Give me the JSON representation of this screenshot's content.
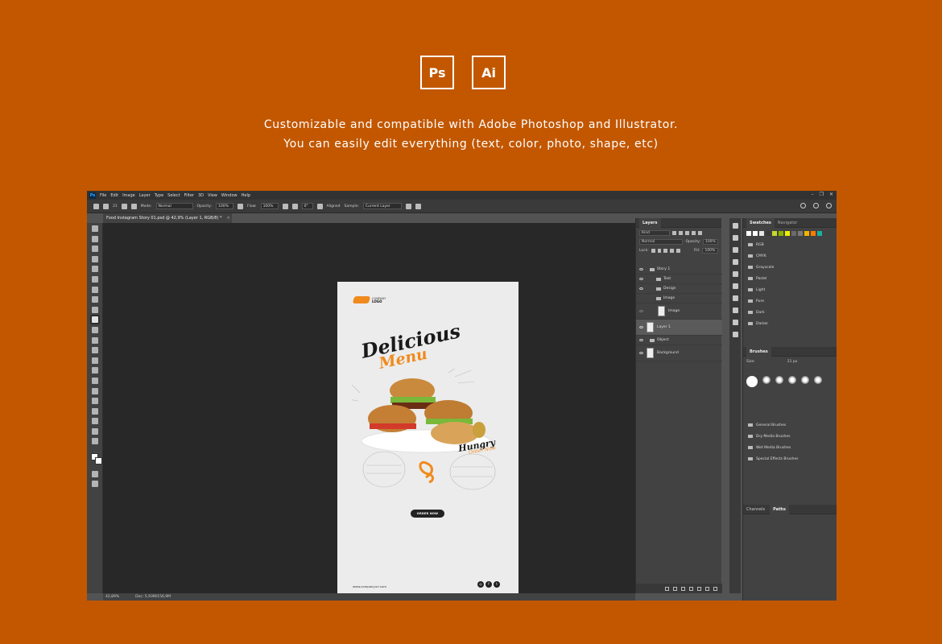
{
  "badges": {
    "ps": "Ps",
    "ai": "Ai"
  },
  "tagline": {
    "line1": "Customizable and compatible with Adobe Photoshop and Illustrator.",
    "line2": "You can easily edit everything (text, color, photo, shape, etc)"
  },
  "menubar": {
    "logo": "Ps",
    "items": [
      "File",
      "Edit",
      "Image",
      "Layer",
      "Type",
      "Select",
      "Filter",
      "3D",
      "View",
      "Window",
      "Help"
    ]
  },
  "options": {
    "brush_size": "21",
    "mode_label": "Mode:",
    "mode_value": "Normal",
    "opacity_label": "Opacity:",
    "opacity_value": "100%",
    "flow_label": "Flow:",
    "flow_value": "100%",
    "angle_value": "0°",
    "aligned_label": "Aligned",
    "sample_label": "Sample:",
    "sample_value": "Current Layer"
  },
  "document_tab": {
    "title": "Food Instagram Story 01.psd @ 42,9% (Layer 1, RGB/8) *",
    "close": "×"
  },
  "document": {
    "logo_line1": "COMPANY",
    "logo_line2": "LOGO",
    "title1": "Delicious",
    "title2": "Menu",
    "hungry": "Hungry",
    "order_menu": "Order Now",
    "button": "ORDER NOW",
    "url": "www.companyurl.com"
  },
  "layers": {
    "tab": "Layers",
    "kind": "Kind",
    "blend": "Normal",
    "opacity_label": "Opacity:",
    "opacity_value": "100%",
    "lock_label": "Lock:",
    "fill_label": "Fill:",
    "fill_value": "100%",
    "items": [
      {
        "name": "Story 1",
        "type": "group"
      },
      {
        "name": "Text",
        "type": "group"
      },
      {
        "name": "Design",
        "type": "group"
      },
      {
        "name": "Image",
        "type": "group"
      },
      {
        "name": "Image",
        "type": "layer"
      },
      {
        "name": "Layer 1",
        "type": "layer",
        "selected": true
      },
      {
        "name": "Object",
        "type": "group"
      },
      {
        "name": "Background",
        "type": "layer"
      }
    ]
  },
  "swatches": {
    "tab": "Swatches",
    "tab2": "Navigator",
    "colors": [
      "#ffffff",
      "#ffffff",
      "#e6e6e6",
      "#3a3a3a",
      "#c7d82a",
      "#8bb400",
      "#f0f000",
      "#6a6a6a",
      "#7a7a7a",
      "#f0b400",
      "#ff7a00",
      "#1ab0a0"
    ],
    "folders": [
      "RGB",
      "CMYK",
      "Grayscale",
      "Pastel",
      "Light",
      "Pure",
      "Dark",
      "Darker"
    ]
  },
  "brushes": {
    "tab": "Brushes",
    "size_label": "Size:",
    "size_value": "21 px",
    "groups": [
      "General Brushes",
      "Dry Media Brushes",
      "Wet Media Brushes",
      "Special Effects Brushes"
    ]
  },
  "channels": {
    "tab1": "Channels",
    "tab2": "Paths"
  },
  "status": {
    "zoom": "42,89%",
    "doc": "Doc: 5,93M/156,9M"
  }
}
